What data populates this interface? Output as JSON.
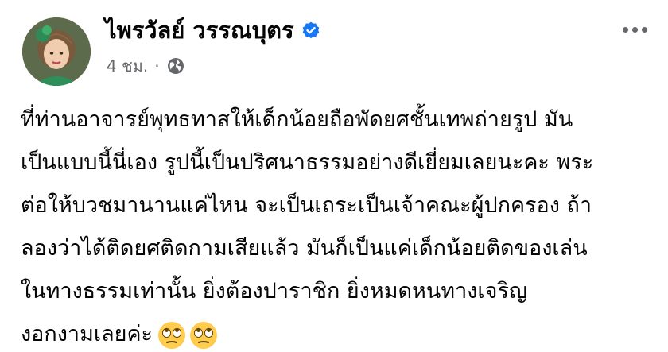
{
  "post": {
    "author": {
      "name": "ไพรวัลย์ วรรณบุตร",
      "verified": true,
      "avatar_icon": "profile-photo"
    },
    "meta": {
      "timestamp": "4 ชม.",
      "separator": "·",
      "audience_icon": "globe-icon"
    },
    "menu_icon": "more-options-icon",
    "body_lines": [
      "ที่ท่านอาจารย์พุทธทาสให้เด็กน้อยถือพัดยศชั้นเทพถ่ายรูป มัน",
      "เป็นแบบนี้นี่เอง รูปนี้เป็นปริศนาธรรมอย่างดีเยี่ยมเลยนะคะ พระ",
      "ต่อให้บวชมานานแค่ไหน จะเป็นเถระเป็นเจ้าคณะผู้ปกครอง ถ้า",
      "ลองว่าได้ติดยศติดกามเสียแล้ว มันก็เป็นแค่เด็กน้อยติดของเล่น",
      "ในทางธรรมเท่านั้น ยิ่งต้องปาราชิก ยิ่งหมดหนทางเจริญ",
      "งอกงามเลยค่ะ"
    ],
    "emojis": [
      "face-with-rolling-eyes",
      "face-with-rolling-eyes"
    ]
  },
  "colors": {
    "text_primary": "#050505",
    "text_secondary": "#65676b",
    "verified_blue": "#1877f2"
  }
}
